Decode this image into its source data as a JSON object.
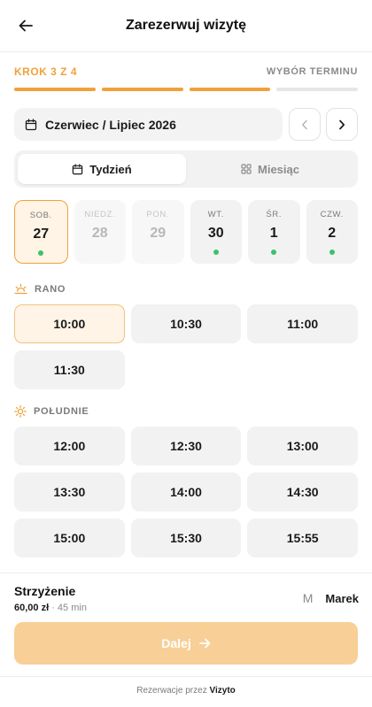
{
  "header": {
    "title": "Zarezerwuj wizytę",
    "back_icon": "arrow-left-icon"
  },
  "steps": {
    "label": "KROK 3 Z 4",
    "name": "WYBÓR TERMINU",
    "current": 3,
    "total": 4
  },
  "calendar": {
    "month_label": "Czerwiec / Lipiec 2026",
    "view_week": "Tydzień",
    "view_month": "Miesiąc",
    "active_view": "week",
    "days": [
      {
        "name": "SOB.",
        "num": "27",
        "state": "selected",
        "available": true
      },
      {
        "name": "NIEDZ.",
        "num": "28",
        "state": "disabled",
        "available": false
      },
      {
        "name": "PON.",
        "num": "29",
        "state": "disabled",
        "available": false
      },
      {
        "name": "WT.",
        "num": "30",
        "state": "normal",
        "available": true
      },
      {
        "name": "ŚR.",
        "num": "1",
        "state": "normal",
        "available": true
      },
      {
        "name": "CZW.",
        "num": "2",
        "state": "normal",
        "available": true
      }
    ]
  },
  "morning": {
    "label": "RANO",
    "slots": [
      "10:00",
      "10:30",
      "11:00",
      "11:30"
    ],
    "selected_index": 0
  },
  "afternoon": {
    "label": "POŁUDNIE",
    "slots": [
      "12:00",
      "12:30",
      "13:00",
      "13:30",
      "14:00",
      "14:30",
      "15:00",
      "15:30",
      "15:55"
    ]
  },
  "summary": {
    "service": "Strzyżenie",
    "price": "60,00 zł",
    "separator": " · ",
    "duration": "45 min",
    "staff_initial": "M",
    "staff_name": "Marek"
  },
  "next_label": "Dalej",
  "footer": {
    "prefix": "Rezerwacje przez",
    "brand": "Vizyto"
  },
  "colors": {
    "accent": "#f0a13a",
    "accent_light": "#fff4e6",
    "button_disabled": "#f8cf97",
    "available_dot": "#3cc269"
  }
}
